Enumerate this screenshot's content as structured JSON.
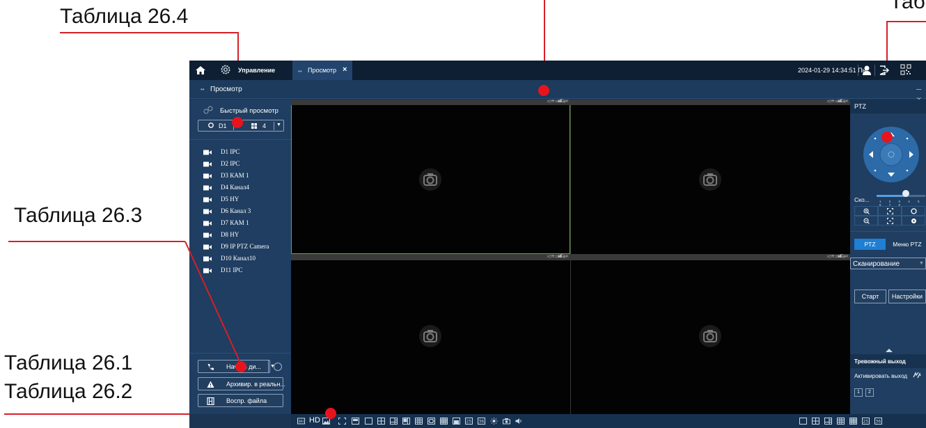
{
  "annotations": {
    "table_26_4": "Таблица 26.4",
    "table_26_3": "Таблица 26.3",
    "table_26_1": "Таблица 26.1",
    "table_26_2": "Таблица 26.2",
    "table_right_partial": "Таб"
  },
  "topbar": {
    "home_icon": "home-icon",
    "settings_label": "Управление",
    "tab_label": "Просмотр",
    "tab_close": "×",
    "datetime": "2024-01-29 14:34:51 Пн"
  },
  "subbar": {
    "title": "Просмотр",
    "minimize": "– ×"
  },
  "sidebar": {
    "quick_view_label": "Быстрый просмотр",
    "device_label": "D1",
    "layout_value": "4",
    "channels": [
      "D1 IPC",
      "D2 IPC",
      "D3 КАМ 1",
      "D4 Канал4",
      "D5 HY",
      "D6 Канал 3",
      "D7 КАМ 1",
      "D8 HY",
      "D9 IP PTZ Camera",
      "D10 Канал10",
      "D11 IPC"
    ],
    "talk_label": "Начать ди...",
    "record_label": "Архивир. в реальн...",
    "playback_label": "Воспр. файла"
  },
  "video": {
    "pane_toolbar_icons": "⌕⊙✥ ▭◙◧⊕✕"
  },
  "bottombar": {
    "hd_label": "HD",
    "split_options_left": [
      "1",
      "4",
      "6",
      "8",
      "9",
      "13",
      "16",
      "16b",
      "25",
      "36"
    ],
    "split_options_right": [
      "1",
      "4",
      "6",
      "9",
      "16",
      "25",
      "36"
    ],
    "split_label_25": "25",
    "split_label_36": "36"
  },
  "ptz": {
    "header": "PTZ",
    "speed_label": "Ско...",
    "speed_value": 0.6,
    "speed_ticks": "1 2 3 4 5 6 7 8",
    "tab_ptz": "PTZ",
    "tab_menu": "Меню PTZ",
    "scan_value": "Сканирование",
    "start_label": "Старт",
    "settings_label": "Настройки"
  },
  "alarm": {
    "header": "Тревожный выход",
    "activate_label": "Активировать выход",
    "outputs": [
      "1",
      "2"
    ]
  },
  "colors": {
    "accent": "#1e7fd4",
    "annotation": "#d81e27",
    "panel_bg": "#1f3e61",
    "active_pane": "#5fb13d"
  }
}
